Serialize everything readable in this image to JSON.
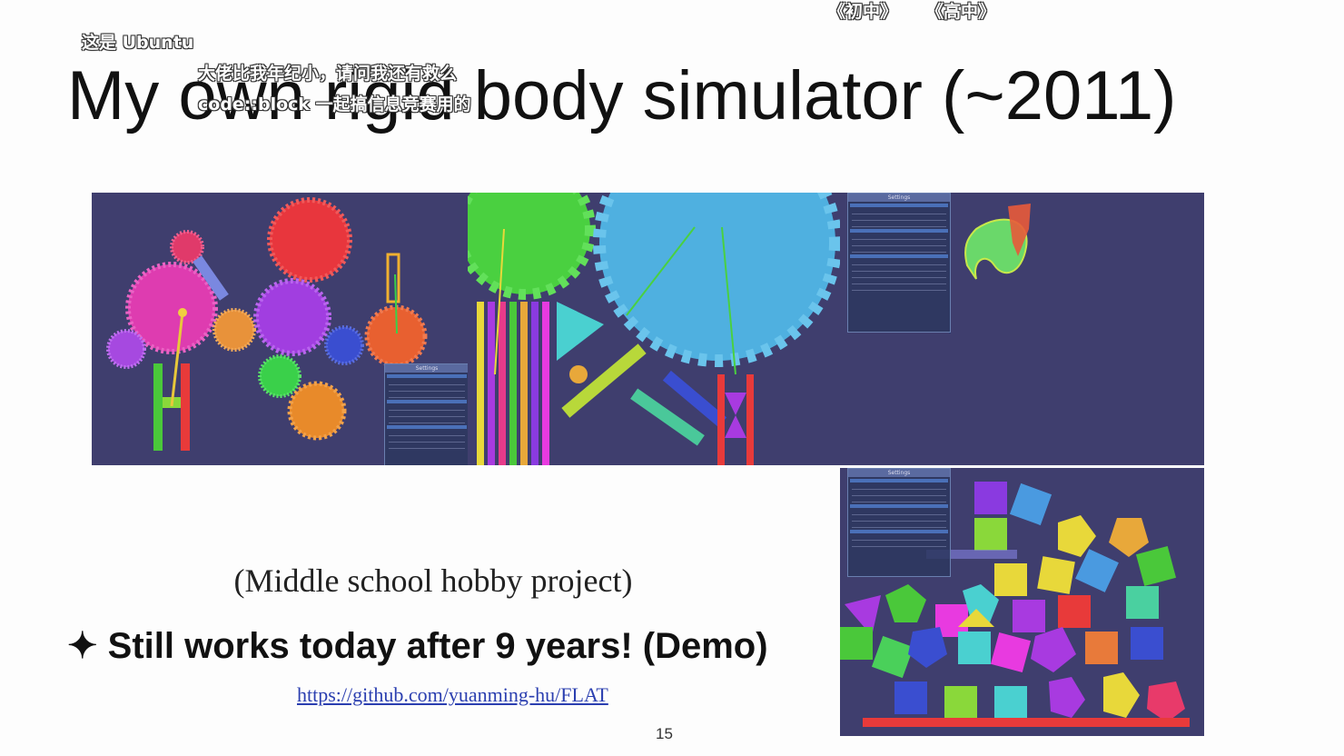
{
  "slide": {
    "title": "My own rigid body simulator (~2011)",
    "subtitle": "(Middle school hobby project)",
    "bullet_symbol": "✦",
    "bullet_text": "Still works today after 9 years! (Demo)",
    "link": "https://github.com/yuanming-hu/FLAT",
    "page_number": "15"
  },
  "danmaku": [
    "《初中》",
    "《高中》",
    "这是 Ubuntu",
    "大佬比我年纪小，请问我还有救么",
    "code::block 一起搞信息竞赛用的"
  ],
  "panels": {
    "background_color": "#3f3e6e",
    "settings_label": "Settings"
  },
  "colors": {
    "title": "#111111",
    "link": "#2b3fb0"
  }
}
